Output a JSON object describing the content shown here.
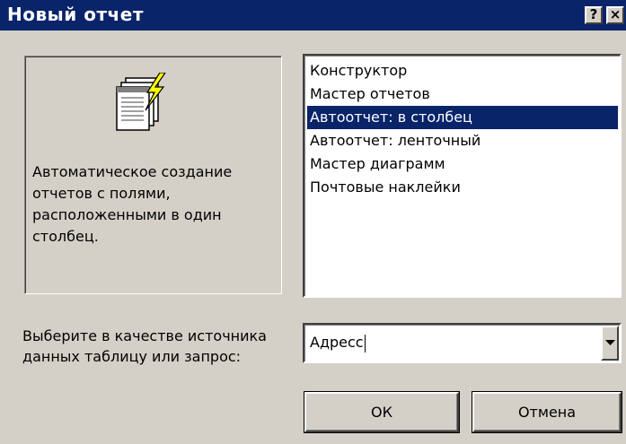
{
  "window": {
    "title": "Новый отчет",
    "help_label": "?",
    "close_label": "×"
  },
  "preview": {
    "icon": "report-wizard-icon",
    "description": "Автоматическое создание отчетов с полями, расположенными в один столбец."
  },
  "report_types": {
    "items": [
      {
        "label": "Конструктор",
        "selected": false
      },
      {
        "label": "Мастер отчетов",
        "selected": false
      },
      {
        "label": "Автоотчет: в столбец",
        "selected": true
      },
      {
        "label": "Автоотчет: ленточный",
        "selected": false
      },
      {
        "label": "Мастер диаграмм",
        "selected": false
      },
      {
        "label": "Почтовые наклейки",
        "selected": false
      }
    ]
  },
  "source": {
    "label": "Выберите в качестве источника данных таблицу или запрос:",
    "value": "Адресс"
  },
  "buttons": {
    "ok": "ОК",
    "cancel": "Отмена"
  },
  "colors": {
    "titlebar": "#0a246a",
    "selection": "#0a246a",
    "face": "#d4d0c8"
  }
}
